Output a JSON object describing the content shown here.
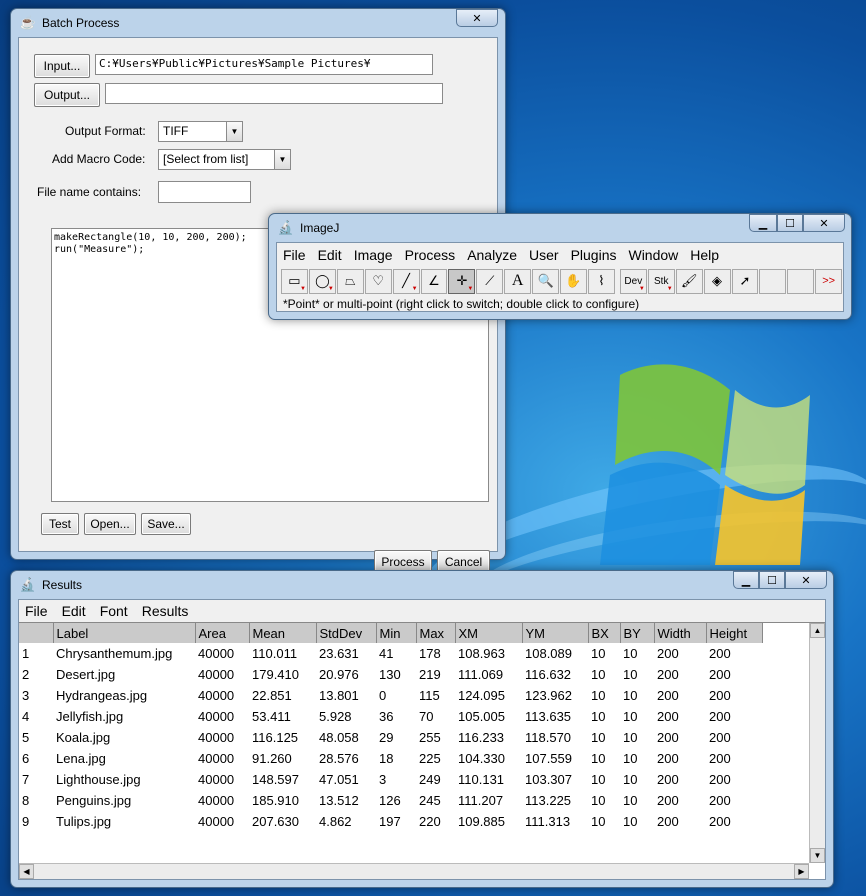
{
  "batch": {
    "title": "Batch Process",
    "input_button": "Input...",
    "input_path": "C:¥Users¥Public¥Pictures¥Sample Pictures¥",
    "output_button": "Output...",
    "output_path": "",
    "output_format_label": "Output Format:",
    "output_format_value": "TIFF",
    "macro_code_label": "Add Macro Code:",
    "macro_code_value": "[Select from list]",
    "filename_label": "File name contains:",
    "filename_value": "",
    "macro_line1": "makeRectangle(10, 10, 200, 200);",
    "macro_line2": "run(\"Measure\");",
    "test_button": "Test",
    "open_button": "Open...",
    "save_button": "Save...",
    "process_button": "Process",
    "cancel_button": "Cancel"
  },
  "imagej": {
    "title": "ImageJ",
    "menus": [
      "File",
      "Edit",
      "Image",
      "Process",
      "Analyze",
      "User",
      "Plugins",
      "Window",
      "Help"
    ],
    "dev_label": "Dev",
    "stk_label": "Stk",
    "more_label": ">>",
    "status": "*Point* or multi-point (right click to switch; double click to configure)"
  },
  "results": {
    "title": "Results",
    "menus": [
      "File",
      "Edit",
      "Font",
      "Results"
    ],
    "columns": [
      "",
      "Label",
      "Area",
      "Mean",
      "StdDev",
      "Min",
      "Max",
      "XM",
      "YM",
      "BX",
      "BY",
      "Width",
      "Height"
    ],
    "rows": [
      [
        "1",
        "Chrysanthemum.jpg",
        "40000",
        "110.011",
        "23.631",
        "41",
        "178",
        "108.963",
        "108.089",
        "10",
        "10",
        "200",
        "200"
      ],
      [
        "2",
        "Desert.jpg",
        "40000",
        "179.410",
        "20.976",
        "130",
        "219",
        "111.069",
        "116.632",
        "10",
        "10",
        "200",
        "200"
      ],
      [
        "3",
        "Hydrangeas.jpg",
        "40000",
        "22.851",
        "13.801",
        "0",
        "115",
        "124.095",
        "123.962",
        "10",
        "10",
        "200",
        "200"
      ],
      [
        "4",
        "Jellyfish.jpg",
        "40000",
        "53.411",
        "5.928",
        "36",
        "70",
        "105.005",
        "113.635",
        "10",
        "10",
        "200",
        "200"
      ],
      [
        "5",
        "Koala.jpg",
        "40000",
        "116.125",
        "48.058",
        "29",
        "255",
        "116.233",
        "118.570",
        "10",
        "10",
        "200",
        "200"
      ],
      [
        "6",
        "Lena.jpg",
        "40000",
        "91.260",
        "28.576",
        "18",
        "225",
        "104.330",
        "107.559",
        "10",
        "10",
        "200",
        "200"
      ],
      [
        "7",
        "Lighthouse.jpg",
        "40000",
        "148.597",
        "47.051",
        "3",
        "249",
        "110.131",
        "103.307",
        "10",
        "10",
        "200",
        "200"
      ],
      [
        "8",
        "Penguins.jpg",
        "40000",
        "185.910",
        "13.512",
        "126",
        "245",
        "111.207",
        "113.225",
        "10",
        "10",
        "200",
        "200"
      ],
      [
        "9",
        "Tulips.jpg",
        "40000",
        "207.630",
        "4.862",
        "197",
        "220",
        "109.885",
        "111.313",
        "10",
        "10",
        "200",
        "200"
      ]
    ]
  },
  "colors": {
    "titlebar": "#bcd3ea",
    "desktop": "#1874c6",
    "header_bg": "#cacaca"
  }
}
